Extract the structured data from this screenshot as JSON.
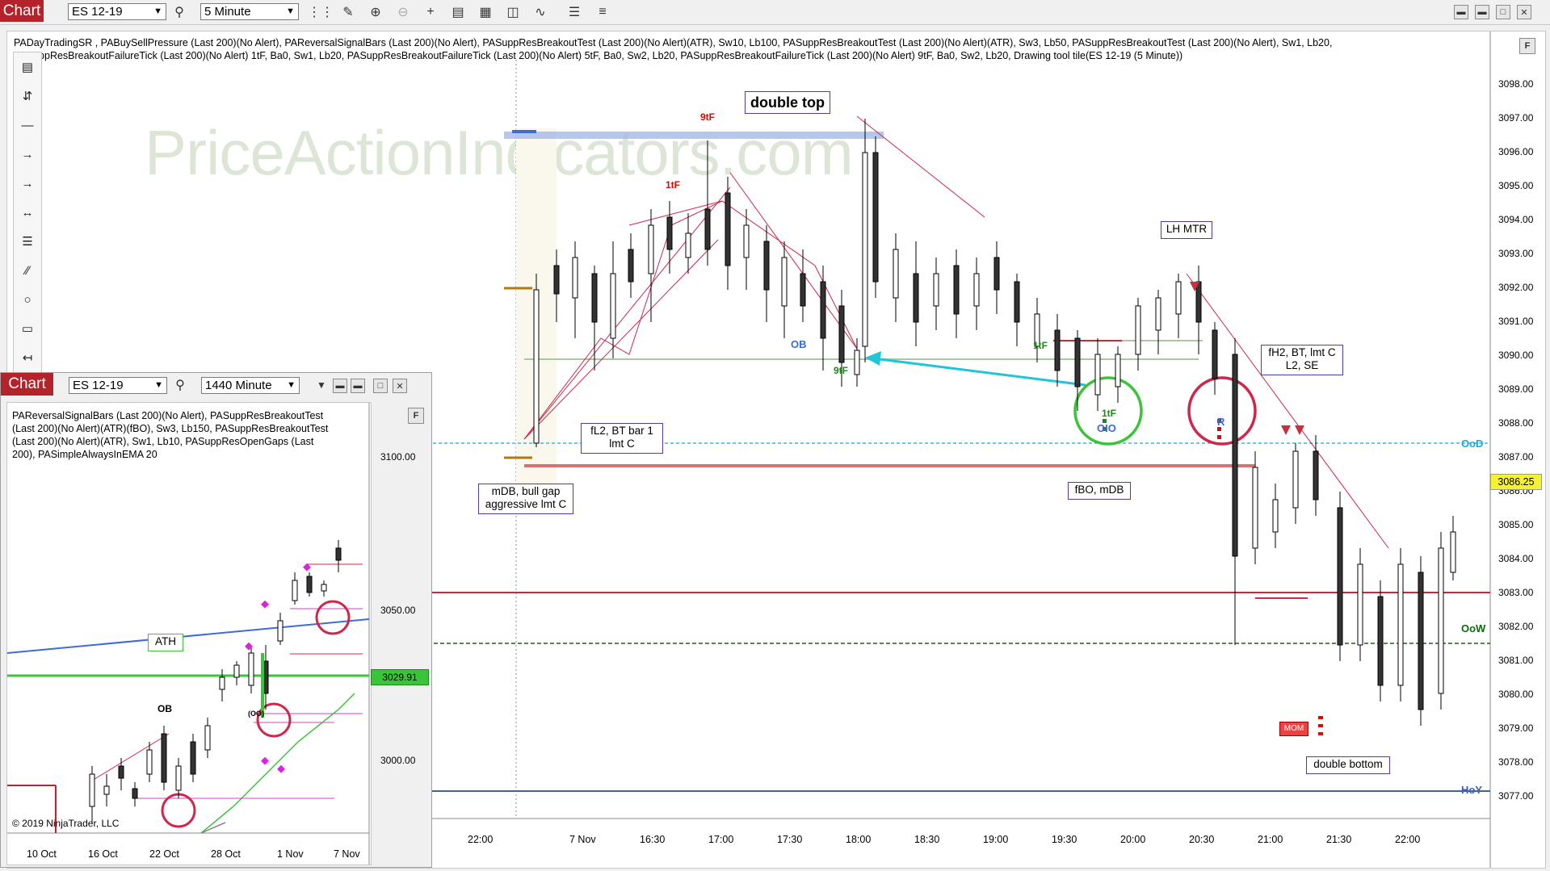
{
  "toolbar": {
    "tab_label": "Chart",
    "instrument": "ES 12-19",
    "interval": "5 Minute",
    "icons": [
      "search-icon",
      "bar-type-icon",
      "pencil-icon",
      "zoom-in-icon",
      "zoom-out-icon",
      "crosshair-icon",
      "data-box-icon",
      "properties-icon",
      "indicators-icon",
      "strategy-icon",
      "templates-icon",
      "order-panel-icon"
    ]
  },
  "window": {
    "buttons": [
      "minimize",
      "restore",
      "maximize",
      "close"
    ]
  },
  "main": {
    "indicator_line1": "PADayTradingSR , PABuySellPressure (Last 200)(No Alert), PAReversalSignalBars (Last 200)(No Alert), PASuppResBreakoutTest (Last 200)(No Alert)(ATR),  Sw10,  Lb100, PASuppResBreakoutTest (Last 200)(No Alert)(ATR),  Sw3,  Lb50, PASuppResBreakoutTest (Last 200)(No Alert),  Sw1,  Lb20,",
    "indicator_line2": "PASuppResBreakoutFailureTick (Last 200)(No Alert) 1tF,  Ba0,  Sw1,  Lb20, PASuppResBreakoutFailureTick (Last 200)(No Alert) 5tF,  Ba0,  Sw2,  Lb20, PASuppResBreakoutFailureTick (Last 200)(No Alert) 9tF,  Ba0,  Sw2,  Lb20, Drawing tool tile(ES 12-19 (5 Minute))",
    "watermark": "PriceActionIndicators.com",
    "y_ticks": [
      "3098.00",
      "3097.00",
      "3096.00",
      "3095.00",
      "3094.00",
      "3093.00",
      "3092.00",
      "3091.00",
      "3090.00",
      "3089.00",
      "3088.00",
      "3087.00",
      "3086.00",
      "3085.00",
      "3084.00",
      "3083.00",
      "3082.00",
      "3081.00",
      "3080.00",
      "3079.00",
      "3078.00",
      "3077.00"
    ],
    "x_ticks": [
      "22:00",
      "7 Nov",
      "16:30",
      "17:00",
      "17:30",
      "18:00",
      "18:30",
      "19:00",
      "19:30",
      "20:00",
      "20:30",
      "21:00",
      "21:30",
      "22:00"
    ],
    "last_price": "3086.25",
    "level_labels": {
      "ood": "OoD",
      "oow": "OoW",
      "hoy": "HoY"
    },
    "annotations": {
      "double_top": "double top",
      "lh_mtr": "LH MTR",
      "fh2": "fH2, BT, lmt C\nL2, SE",
      "fl2": "fL2, BT bar 1\nlmt C",
      "mdb": "mDB, bull gap\naggressive lmt C",
      "fbo": "fBO, mDB",
      "double_bottom": "double bottom",
      "mom": "MOM",
      "t9tf_top": "9tF",
      "t1tf_top": "1tF",
      "t9tf_low": "9tF",
      "t1tf_mid": "1tF",
      "t1tf_circle": "1tF",
      "ob": "OB",
      "oio": "OIO",
      "r": "R"
    }
  },
  "sub": {
    "tab_label": "Chart",
    "instrument": "ES 12-19",
    "interval": "1440 Minute",
    "indicator_text": "PAReversalSignalBars (Last 200)(No Alert), PASuppResBreakoutTest (Last 200)(No Alert)(ATR)(fBO),  Sw3,  Lb150, PASuppResBreakoutTest (Last 200)(No Alert)(ATR),  Sw1,  Lb10, PASuppResOpenGaps (Last 200), PASimpleAlwaysInEMA   20",
    "y_ticks": [
      "3100.00",
      "3050.00",
      "3000.00"
    ],
    "last_price": "3029.91",
    "x_ticks": [
      "10 Oct",
      "16 Oct",
      "22 Oct",
      "28 Oct",
      "1 Nov",
      "7 Nov"
    ],
    "ath": "ATH",
    "ob": "OB",
    "oo": "(OO)",
    "copyright": "© 2019 NinjaTrader, LLC",
    "f_button": "F"
  },
  "colors": {
    "tab_red": "#b5232a",
    "level_red": "#d0263a",
    "level_blue": "#3f5fb5",
    "ood_cyan": "#1aa8d8",
    "oow_green": "#0a6b0a",
    "annot_border": "#4b3bb5"
  }
}
